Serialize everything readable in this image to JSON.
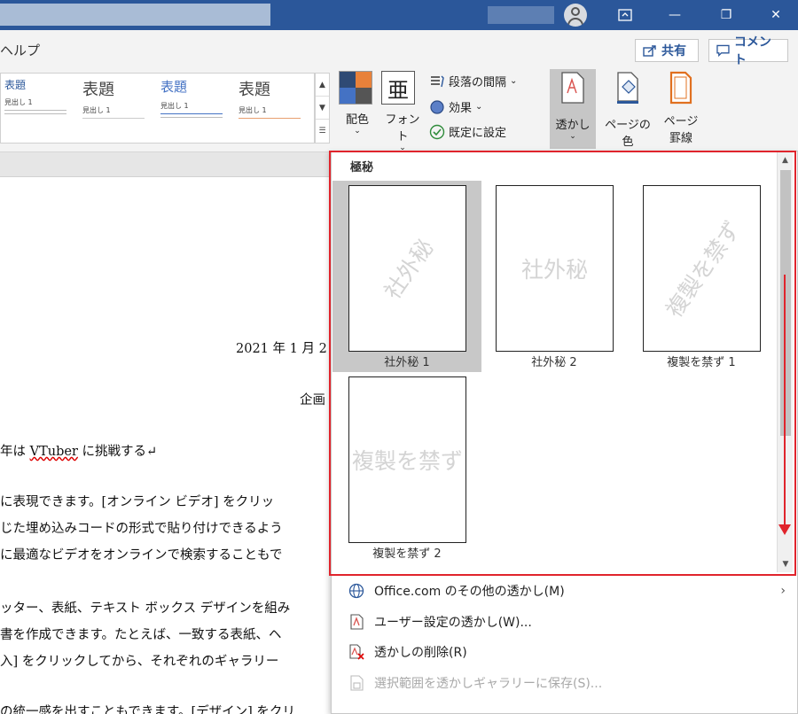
{
  "window": {
    "min": "—",
    "restore": "❐",
    "close": "✕"
  },
  "ribbon_tabs": {
    "help": "ヘルプ",
    "share": "共有",
    "comment": "コメント"
  },
  "style_gallery": [
    {
      "title": "表題",
      "sub": "見出し 1"
    },
    {
      "title": "表題",
      "sub": "見出し 1"
    },
    {
      "title": "表題",
      "sub": "見出し 1"
    },
    {
      "title": "表題",
      "sub": "見出し 1"
    }
  ],
  "design_ribbon": {
    "colors": "配色",
    "fonts": "フォント",
    "font_glyph": "亜",
    "paragraph_spacing": "段落の間隔",
    "effects": "効果",
    "set_default": "既定に設定",
    "watermark": "透かし",
    "page_color": "ページの色",
    "page_borders_1": "ページ",
    "page_borders_2": "罫線"
  },
  "document": {
    "date": "2021 年 1 月 2",
    "dept": "企画",
    "line1_pre": "年は ",
    "line1_word": "VTuber",
    "line1_post": " に挑戦する↵",
    "p1": [
      "に表現できます。[オンライン ビデオ] をクリッ",
      "じた埋め込みコードの形式で貼り付けできるよう",
      "に最適なビデオをオンラインで検索することもで"
    ],
    "p2": [
      "ッター、表紙、テキスト ボックス デザインを組み",
      "書を作成できます。たとえば、一致する表紙、ヘ",
      "入] をクリックしてから、それぞれのギャラリー"
    ],
    "p3": "の統一感を出すこともできます。[デザイン] をクリ"
  },
  "watermark_gallery": {
    "section": "極秘",
    "items": [
      {
        "label": "社外秘 1",
        "text": "社外秘"
      },
      {
        "label": "社外秘 2",
        "text": "社外秘"
      },
      {
        "label": "複製を禁ず 1",
        "text": "複製を禁ず"
      },
      {
        "label": "複製を禁ず 2",
        "text": "複製を禁ず"
      }
    ]
  },
  "menu": {
    "more": "Office.com のその他の透かし(M)",
    "custom": "ユーザー設定の透かし(W)...",
    "remove": "透かしの削除(R)",
    "save_selection": "選択範囲を透かしギャラリーに保存(S)..."
  },
  "colors": {
    "accent": "#2b579a",
    "highlight": "#e0242c"
  }
}
